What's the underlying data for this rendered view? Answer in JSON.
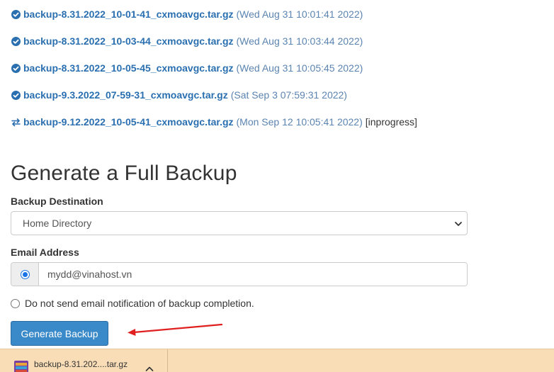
{
  "backups": [
    {
      "file": "backup-8.31.2022_10-01-41_cxmoavgc.tar.gz",
      "date": "(Wed Aug 31 10:01:41 2022)",
      "status": "",
      "icon": "check-circle-icon"
    },
    {
      "file": "backup-8.31.2022_10-03-44_cxmoavgc.tar.gz",
      "date": "(Wed Aug 31 10:03:44 2022)",
      "status": "",
      "icon": "check-circle-icon"
    },
    {
      "file": "backup-8.31.2022_10-05-45_cxmoavgc.tar.gz",
      "date": "(Wed Aug 31 10:05:45 2022)",
      "status": "",
      "icon": "check-circle-icon"
    },
    {
      "file": "backup-9.3.2022_07-59-31_cxmoavgc.tar.gz",
      "date": "(Sat Sep 3 07:59:31 2022)",
      "status": "",
      "icon": "check-circle-icon"
    },
    {
      "file": "backup-9.12.2022_10-05-41_cxmoavgc.tar.gz",
      "date": "(Mon Sep 12 10:05:41 2022)",
      "status": "[inprogress]",
      "icon": "transfer-arrows-icon"
    }
  ],
  "full_backup": {
    "title": "Generate a Full Backup",
    "destination_label": "Backup Destination",
    "destination_value": "Home Directory",
    "email_label": "Email Address",
    "email_value": "mydd@vinahost.vn",
    "no_email_label": "Do not send email notification of backup completion.",
    "generate_button": "Generate Backup"
  },
  "download_bar": {
    "file_name": "backup-8.31.202....tar.gz"
  },
  "colors": {
    "link": "#2a6fb0",
    "date": "#5b84b1",
    "button": "#3a89c9",
    "annotation_arrow": "#e02020",
    "download_bar": "#f8ddb7"
  }
}
